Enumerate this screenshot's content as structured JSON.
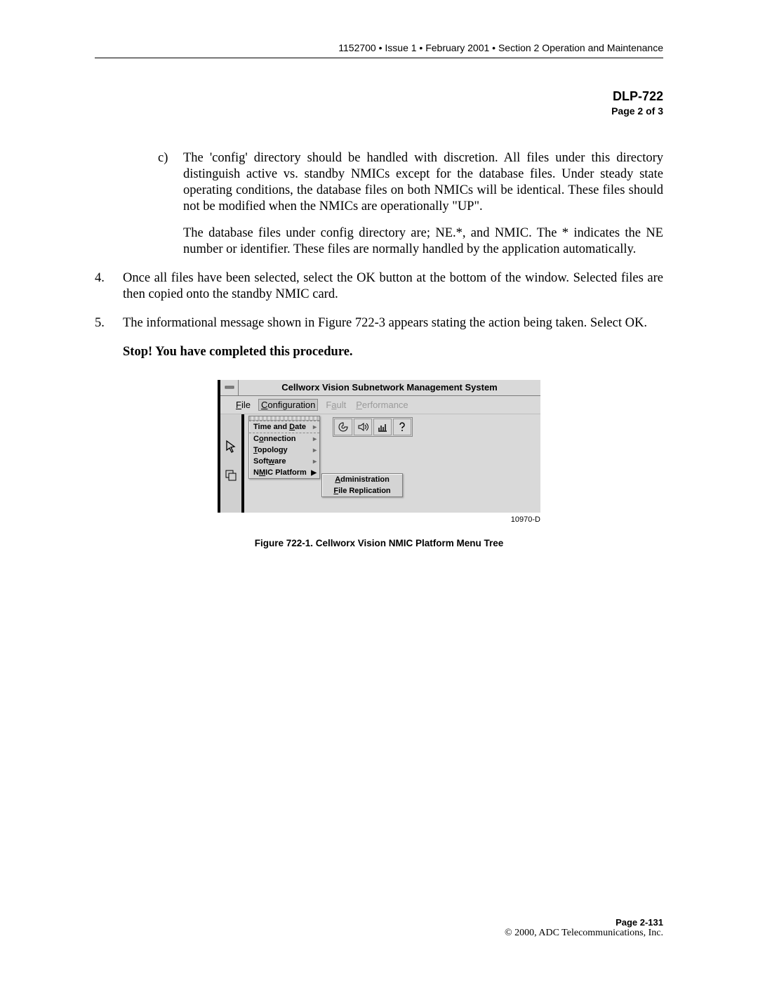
{
  "header": "1152700 • Issue 1 • February 2001 • Section 2 Operation and Maintenance",
  "dlp": {
    "title": "DLP-722",
    "page": "Page 2 of 3"
  },
  "items": {
    "c_marker": "c)",
    "c_para1": "The 'config' directory should be handled with discretion. All files under this directory distinguish active vs. standby NMICs except for the database files. Under steady state operating conditions, the database files on both NMICs will be identical. These files should not be modified when the NMICs are operationally \"UP\".",
    "c_para2": "The database files under config directory are; NE.*, and NMIC. The * indicates the NE number or identifier. These files are normally handled by the application automatically.",
    "n4_marker": "4.",
    "n4_para": "Once all files have been selected, select the OK button at the bottom of the window. Selected files are then copied onto the standby NMIC card.",
    "n5_marker": "5.",
    "n5_para": "The informational message shown in Figure 722-3 appears stating the action being taken. Select OK.",
    "stop": "Stop! You have completed this procedure."
  },
  "figure": {
    "app_title": "Cellworx Vision Subnetwork Management System",
    "menus": {
      "file": "File",
      "configuration": "Configuration",
      "fault": "Fault",
      "performance": "Performance"
    },
    "dropdown": [
      "Time and Date",
      "Connection",
      "Topology",
      "Software",
      "NMIC Platform"
    ],
    "submenu": [
      "Administration",
      "File Replication"
    ],
    "id": "10970-D",
    "caption": "Figure 722-1.  Cellworx Vision NMIC Platform Menu Tree"
  },
  "footer": {
    "page": "Page 2-131",
    "copy": "© 2000, ADC Telecommunications, Inc."
  }
}
